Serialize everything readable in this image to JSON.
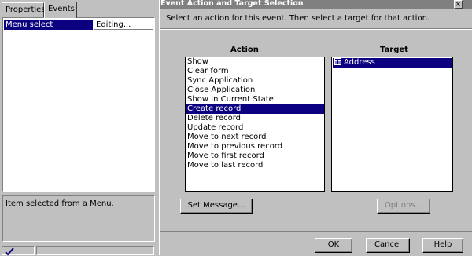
{
  "left_panel": {
    "tabs": [
      {
        "label": "Properties"
      },
      {
        "label": "Events"
      }
    ],
    "event": {
      "name": "Menu select",
      "value": "Editing..."
    },
    "description": "Item selected from a Menu."
  },
  "dialog": {
    "title": "Event Action and Target Selection",
    "close_label": "×",
    "instructions": "Select an action for this event. Then select a target for that action.",
    "action_header": "Action",
    "target_header": "Target",
    "actions": [
      {
        "label": "Show"
      },
      {
        "label": "Clear form"
      },
      {
        "label": "Sync Application"
      },
      {
        "label": "Close Application"
      },
      {
        "label": "Show In Current State"
      },
      {
        "label": "Create record",
        "selected": true
      },
      {
        "label": "Delete record"
      },
      {
        "label": "Update record"
      },
      {
        "label": "Move to next record"
      },
      {
        "label": "Move to previous record"
      },
      {
        "label": "Move to first record"
      },
      {
        "label": "Move to last record"
      }
    ],
    "targets": [
      {
        "label": "Address",
        "icon": "table-icon",
        "selected": true
      }
    ],
    "buttons": {
      "set_message": "Set Message...",
      "options": "Options...",
      "ok": "OK",
      "cancel": "Cancel",
      "help": "Help"
    }
  },
  "colors": {
    "selection": "#0a0080",
    "face": "#c0c0c0",
    "titlebar": "#808080"
  }
}
